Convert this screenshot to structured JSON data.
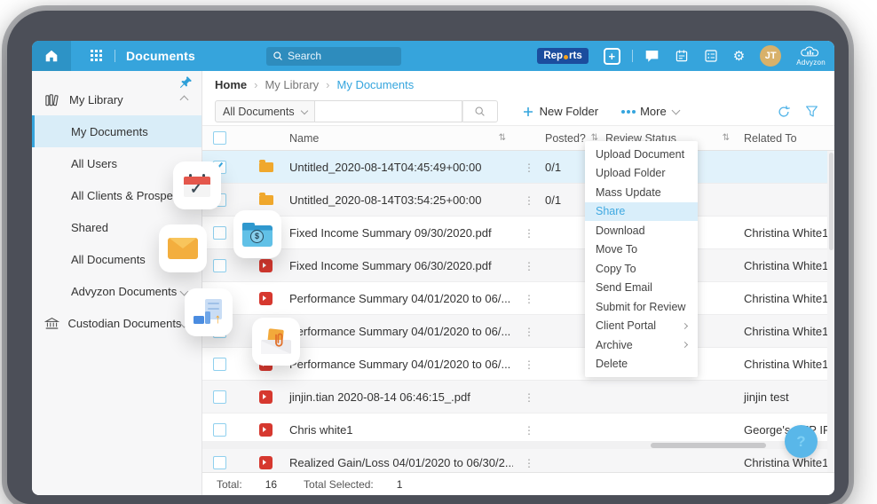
{
  "topbar": {
    "title": "Documents",
    "search_placeholder": "Search",
    "reports": {
      "label": "Reports",
      "pre": "Rep",
      "post": "rts"
    },
    "avatar_initials": "JT",
    "brand": "Advyzon"
  },
  "breadcrumb": {
    "home": "Home",
    "library": "My Library",
    "current": "My Documents"
  },
  "sidebar": {
    "items": [
      {
        "label": "My Library",
        "indent_class": "lvl0",
        "has_library_icon": true,
        "chevron": "up"
      },
      {
        "label": "My Documents",
        "indent_class": "lvl1",
        "selected": true
      },
      {
        "label": "All Users",
        "indent_class": "lvl1"
      },
      {
        "label": "All Clients & Prospects",
        "indent_class": "lvl1"
      },
      {
        "label": "Shared",
        "indent_class": "lvl1"
      },
      {
        "label": "All Documents",
        "indent_class": "lvl1"
      },
      {
        "label": "Advyzon Documents",
        "indent_class": "lvl1",
        "chevron": "down"
      },
      {
        "label": "Custodian Documents",
        "indent_class": "lvl0",
        "has_bank_icon": true,
        "chevron": "down"
      }
    ]
  },
  "toolbar": {
    "filter_value": "All Documents",
    "search_value": "",
    "new_folder_label": "New Folder",
    "more_label": "More"
  },
  "table": {
    "columns": [
      {
        "label": "Name"
      },
      {
        "label": "Posted?"
      },
      {
        "label": "Review Status"
      },
      {
        "label": "Related To"
      }
    ],
    "rows": [
      {
        "is_folder": true,
        "name": "Untitled_2020-08-14T04:45:49+00:00",
        "posted": "0/1",
        "related": "",
        "checked": true,
        "selected": true
      },
      {
        "is_folder": true,
        "name": "Untitled_2020-08-14T03:54:25+00:00",
        "posted": "0/1",
        "related": ""
      },
      {
        "is_pdf": true,
        "name": "Fixed Income Summary 09/30/2020.pdf",
        "posted": "",
        "related": "Christina White1"
      },
      {
        "is_pdf": true,
        "name": "Fixed Income Summary 06/30/2020.pdf",
        "posted": "",
        "related": "Christina White1"
      },
      {
        "is_pdf": true,
        "name": "Performance Summary 04/01/2020 to 06/...",
        "posted": "",
        "related": "Christina White1"
      },
      {
        "is_pdf": true,
        "name": "Performance Summary 04/01/2020 to 06/...",
        "posted": "",
        "related": "Christina White1"
      },
      {
        "is_pdf": true,
        "name": "Performance Summary 04/01/2020 to 06/...",
        "posted": "",
        "related": "Christina White1"
      },
      {
        "is_pdf": true,
        "name": "jinjin.tian 2020-08-14 06:46:15_.pdf",
        "posted": "",
        "related": "jinjin test"
      },
      {
        "is_pdf": true,
        "name": "Chris white1",
        "posted": "",
        "related": "George's SEP IRA"
      },
      {
        "is_pdf": true,
        "name": "Realized Gain/Loss 04/01/2020 to 06/30/2...",
        "posted": "",
        "related": "Christina White1"
      }
    ]
  },
  "context_menu": {
    "items": [
      {
        "label": "Upload Document"
      },
      {
        "label": "Upload Folder"
      },
      {
        "label": "Mass Update"
      },
      {
        "label": "Share",
        "active": true
      },
      {
        "label": "Download"
      },
      {
        "label": "Move To"
      },
      {
        "label": "Copy To"
      },
      {
        "label": "Send Email"
      },
      {
        "label": "Submit for Review"
      },
      {
        "label": "Client Portal",
        "submenu": true
      },
      {
        "label": "Archive",
        "submenu": true
      },
      {
        "label": "Delete"
      }
    ]
  },
  "footer": {
    "total_label": "Total:",
    "total_value": "16",
    "selected_label": "Total Selected:",
    "selected_value": "1"
  },
  "help_button": "?",
  "colors": {
    "topbar": "#36A4DC",
    "accent": "#35A5DE",
    "selected_row": "#E1F2FB",
    "reports_bg": "#1B4D9E",
    "reports_dot": "#F6A21D",
    "folder_icon": "#F0A82D",
    "pdf_icon": "#D6382F"
  }
}
